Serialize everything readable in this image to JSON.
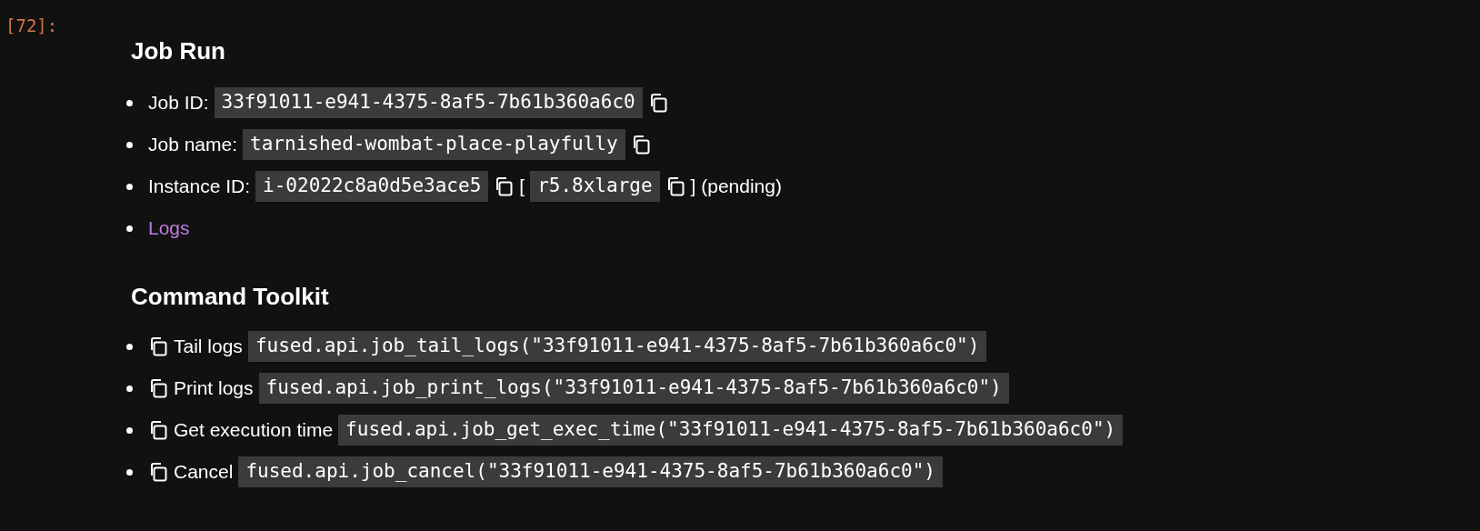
{
  "cell": {
    "prompt": "[72]:"
  },
  "job_run": {
    "title": "Job Run",
    "items": [
      {
        "parts": [
          {
            "kind": "text",
            "text": "Job ID:"
          },
          {
            "kind": "code",
            "text": "33f91011-e941-4375-8af5-7b61b360a6c0"
          },
          {
            "kind": "copy"
          }
        ]
      },
      {
        "parts": [
          {
            "kind": "text",
            "text": "Job name:"
          },
          {
            "kind": "code",
            "text": "tarnished-wombat-place-playfully"
          },
          {
            "kind": "copy"
          }
        ]
      },
      {
        "parts": [
          {
            "kind": "text",
            "text": "Instance ID:"
          },
          {
            "kind": "code",
            "text": "i-02022c8a0d5e3ace5"
          },
          {
            "kind": "copy"
          },
          {
            "kind": "text",
            "text": "["
          },
          {
            "kind": "code",
            "text": "r5.8xlarge"
          },
          {
            "kind": "copy"
          },
          {
            "kind": "text",
            "text": "] (pending)"
          }
        ]
      },
      {
        "parts": [
          {
            "kind": "link",
            "text": "Logs"
          }
        ]
      }
    ]
  },
  "command_toolkit": {
    "title": "Command Toolkit",
    "items": [
      {
        "label": "Tail logs",
        "code": "fused.api.job_tail_logs(\"33f91011-e941-4375-8af5-7b61b360a6c0\")"
      },
      {
        "label": "Print logs",
        "code": "fused.api.job_print_logs(\"33f91011-e941-4375-8af5-7b61b360a6c0\")"
      },
      {
        "label": "Get execution time",
        "code": "fused.api.job_get_exec_time(\"33f91011-e941-4375-8af5-7b61b360a6c0\")"
      },
      {
        "label": "Cancel",
        "code": "fused.api.job_cancel(\"33f91011-e941-4375-8af5-7b61b360a6c0\")"
      }
    ]
  }
}
